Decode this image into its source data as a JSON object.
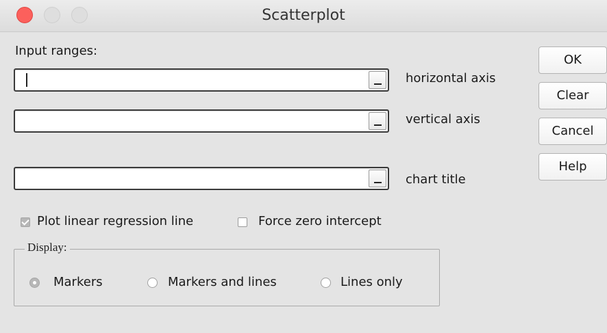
{
  "window": {
    "title": "Scatterplot"
  },
  "input_ranges": {
    "heading": "Input ranges:",
    "fields": [
      {
        "label": "horizontal axis",
        "value": ""
      },
      {
        "label": "vertical axis",
        "value": ""
      },
      {
        "label": "chart title",
        "value": ""
      }
    ]
  },
  "buttons": {
    "ok": "OK",
    "clear": "Clear",
    "cancel": "Cancel",
    "help": "Help"
  },
  "options": {
    "regression": {
      "label": "Plot linear regression line",
      "checked": true
    },
    "zero_intercept": {
      "label": "Force zero intercept",
      "checked": false
    }
  },
  "display": {
    "legend": "Display:",
    "options": [
      {
        "label": "Markers",
        "selected": true
      },
      {
        "label": "Markers and lines",
        "selected": false
      },
      {
        "label": "Lines only",
        "selected": false
      }
    ]
  }
}
